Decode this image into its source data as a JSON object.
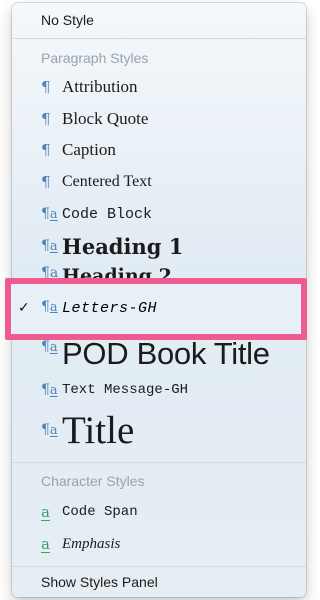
{
  "menu": {
    "no_style": "No Style",
    "paragraph_section": "Paragraph Styles",
    "paragraph_styles": [
      {
        "label": "Attribution",
        "icon": "pilcrow-icon",
        "checked": false
      },
      {
        "label": "Block Quote",
        "icon": "pilcrow-icon",
        "checked": false
      },
      {
        "label": "Caption",
        "icon": "pilcrow-icon",
        "checked": false
      },
      {
        "label": "Centered Text",
        "icon": "pilcrow-icon",
        "checked": false
      },
      {
        "label": "Code Block",
        "icon": "paragraph-char-icon",
        "checked": false
      },
      {
        "label": "Heading 1",
        "icon": "paragraph-char-icon",
        "checked": false
      },
      {
        "label": "Heading 2",
        "icon": "paragraph-char-icon",
        "checked": false
      },
      {
        "label": "Letters-GH",
        "icon": "paragraph-char-icon",
        "checked": true
      },
      {
        "label": "POD Book Title",
        "icon": "paragraph-char-icon",
        "checked": false
      },
      {
        "label": "Text Message-GH",
        "icon": "paragraph-char-icon",
        "checked": false
      },
      {
        "label": "Title",
        "icon": "paragraph-char-icon",
        "checked": false
      }
    ],
    "character_section": "Character Styles",
    "character_styles": [
      {
        "label": "Code Span",
        "icon": "character-style-icon"
      },
      {
        "label": "Emphasis",
        "icon": "character-style-icon"
      }
    ],
    "show_panel": "Show Styles Panel",
    "checkmark": "✓"
  },
  "glyphs": {
    "pilcrow": "¶",
    "para_char_p": "¶",
    "para_char_a": "a",
    "char_a": "a"
  },
  "colors": {
    "highlight_border": "#f05b8f",
    "icon_paragraph": "#4f86b8",
    "icon_character": "#3aa16b",
    "section_text": "#9aa3ab"
  }
}
